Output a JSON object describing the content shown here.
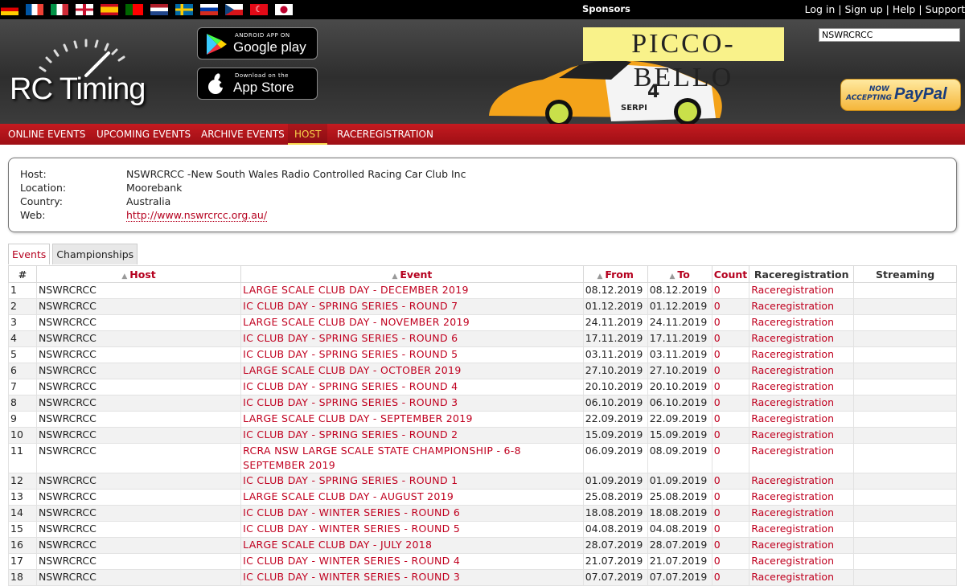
{
  "topbar": {
    "sponsors_label": "Sponsors",
    "links": [
      "Log in",
      "Sign up",
      "Help",
      "Support"
    ],
    "flags": [
      "de",
      "fr",
      "it",
      "gb",
      "es",
      "pt",
      "nl",
      "se",
      "ru",
      "cz",
      "tr",
      "jp"
    ]
  },
  "header": {
    "logo_text": "RC Timing",
    "google_play": {
      "small": "ANDROID APP ON",
      "big": "Google play"
    },
    "app_store": {
      "small": "Download on the",
      "big": "App Store"
    },
    "sponsor_banner": "PICCO-BELLO",
    "search_value": "NSWRCRCC",
    "paypal": {
      "now": "NOW ACCEPTING",
      "brand": "PayPal"
    }
  },
  "nav": {
    "items": [
      "ONLINE EVENTS",
      "UPCOMING EVENTS",
      "ARCHIVE EVENTS",
      "HOST",
      "RACEREGISTRATION"
    ],
    "active": "HOST"
  },
  "info": {
    "host_label": "Host:",
    "host_value": "NSWRCRCC -New South Wales Radio Controlled Racing Car Club Inc",
    "location_label": "Location:",
    "location_value": "Moorebank",
    "country_label": "Country:",
    "country_value": "Australia",
    "web_label": "Web:",
    "web_value": "http://www.nswrcrcc.org.au/"
  },
  "tabs": [
    "Events",
    "Championships"
  ],
  "table": {
    "headers": {
      "num": "#",
      "host": "Host",
      "event": "Event",
      "from": "From",
      "to": "To",
      "count": "Count",
      "reg": "Raceregistration",
      "stream": "Streaming"
    },
    "rows": [
      {
        "n": "1",
        "host": "NSWRCRCC",
        "event": "LARGE SCALE CLUB DAY - DECEMBER 2019",
        "from": "08.12.2019",
        "to": "08.12.2019",
        "count": "0",
        "reg": "Raceregistration"
      },
      {
        "n": "2",
        "host": "NSWRCRCC",
        "event": "IC CLUB DAY - SPRING SERIES - ROUND 7",
        "from": "01.12.2019",
        "to": "01.12.2019",
        "count": "0",
        "reg": "Raceregistration"
      },
      {
        "n": "3",
        "host": "NSWRCRCC",
        "event": "LARGE SCALE CLUB DAY - NOVEMBER 2019",
        "from": "24.11.2019",
        "to": "24.11.2019",
        "count": "0",
        "reg": "Raceregistration"
      },
      {
        "n": "4",
        "host": "NSWRCRCC",
        "event": "IC CLUB DAY - SPRING SERIES - ROUND 6",
        "from": "17.11.2019",
        "to": "17.11.2019",
        "count": "0",
        "reg": "Raceregistration"
      },
      {
        "n": "5",
        "host": "NSWRCRCC",
        "event": "IC CLUB DAY - SPRING SERIES - ROUND 5",
        "from": "03.11.2019",
        "to": "03.11.2019",
        "count": "0",
        "reg": "Raceregistration"
      },
      {
        "n": "6",
        "host": "NSWRCRCC",
        "event": "LARGE SCALE CLUB DAY - OCTOBER 2019",
        "from": "27.10.2019",
        "to": "27.10.2019",
        "count": "0",
        "reg": "Raceregistration"
      },
      {
        "n": "7",
        "host": "NSWRCRCC",
        "event": "IC CLUB DAY - SPRING SERIES - ROUND 4",
        "from": "20.10.2019",
        "to": "20.10.2019",
        "count": "0",
        "reg": "Raceregistration"
      },
      {
        "n": "8",
        "host": "NSWRCRCC",
        "event": "IC CLUB DAY - SPRING SERIES - ROUND 3",
        "from": "06.10.2019",
        "to": "06.10.2019",
        "count": "0",
        "reg": "Raceregistration"
      },
      {
        "n": "9",
        "host": "NSWRCRCC",
        "event": "LARGE SCALE CLUB DAY - SEPTEMBER 2019",
        "from": "22.09.2019",
        "to": "22.09.2019",
        "count": "0",
        "reg": "Raceregistration"
      },
      {
        "n": "10",
        "host": "NSWRCRCC",
        "event": "IC CLUB DAY - SPRING SERIES - ROUND 2",
        "from": "15.09.2019",
        "to": "15.09.2019",
        "count": "0",
        "reg": "Raceregistration"
      },
      {
        "n": "11",
        "host": "NSWRCRCC",
        "event": "RCRA NSW LARGE SCALE STATE CHAMPIONSHIP - 6-8 SEPTEMBER 2019",
        "from": "06.09.2019",
        "to": "08.09.2019",
        "count": "0",
        "reg": "Raceregistration"
      },
      {
        "n": "12",
        "host": "NSWRCRCC",
        "event": "IC CLUB DAY - SPRING SERIES - ROUND 1",
        "from": "01.09.2019",
        "to": "01.09.2019",
        "count": "0",
        "reg": "Raceregistration"
      },
      {
        "n": "13",
        "host": "NSWRCRCC",
        "event": "LARGE SCALE CLUB DAY - AUGUST 2019",
        "from": "25.08.2019",
        "to": "25.08.2019",
        "count": "0",
        "reg": "Raceregistration"
      },
      {
        "n": "14",
        "host": "NSWRCRCC",
        "event": "IC CLUB DAY - WINTER SERIES - ROUND 6",
        "from": "18.08.2019",
        "to": "18.08.2019",
        "count": "0",
        "reg": "Raceregistration"
      },
      {
        "n": "15",
        "host": "NSWRCRCC",
        "event": "IC CLUB DAY - WINTER SERIES - ROUND 5",
        "from": "04.08.2019",
        "to": "04.08.2019",
        "count": "0",
        "reg": "Raceregistration"
      },
      {
        "n": "16",
        "host": "NSWRCRCC",
        "event": "LARGE SCALE CLUB DAY - JULY 2018",
        "from": "28.07.2019",
        "to": "28.07.2019",
        "count": "0",
        "reg": "Raceregistration"
      },
      {
        "n": "17",
        "host": "NSWRCRCC",
        "event": "IC CLUB DAY - WINTER SERIES - ROUND 4",
        "from": "21.07.2019",
        "to": "21.07.2019",
        "count": "0",
        "reg": "Raceregistration"
      },
      {
        "n": "18",
        "host": "NSWRCRCC",
        "event": "IC CLUB DAY - WINTER SERIES - ROUND 3",
        "from": "07.07.2019",
        "to": "07.07.2019",
        "count": "0",
        "reg": "Raceregistration"
      }
    ]
  },
  "colors": {
    "accent": "#c0001f",
    "nav": "#b3151b",
    "active_nav_text": "#f7d34b"
  }
}
